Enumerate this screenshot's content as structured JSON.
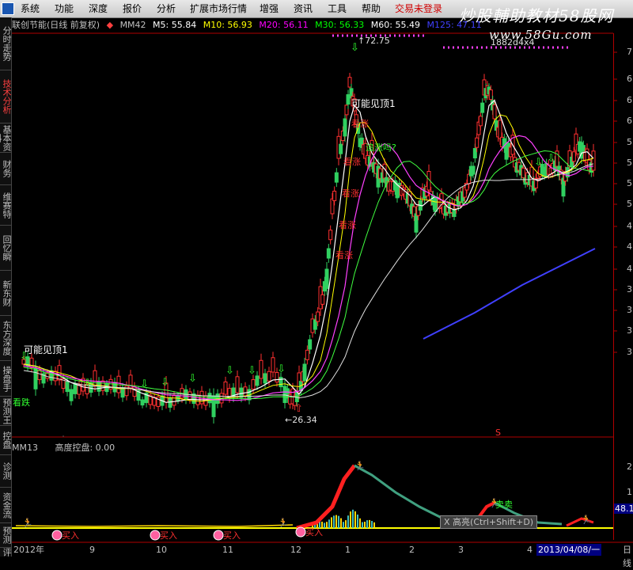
{
  "menu": {
    "items": [
      "系统",
      "功能",
      "深度",
      "报价",
      "分析",
      "扩展市场行情",
      "增强",
      "资讯",
      "工具",
      "帮助"
    ],
    "login": "交易未登录"
  },
  "brand": {
    "title": "炒股輔助教材58股网",
    "url": "www.58Gu.com"
  },
  "stock": {
    "title": "联创节能(日线 前复权)",
    "indicator": "MM42",
    "ma": [
      {
        "label": "M5: 55.84",
        "color": "#ffffff"
      },
      {
        "label": "M10: 56.93",
        "color": "#ffff00"
      },
      {
        "label": "M20: 56.11",
        "color": "#ff00ff"
      },
      {
        "label": "M30: 56.33",
        "color": "#00ff00"
      },
      {
        "label": "M60: 55.49",
        "color": "#ffffff"
      },
      {
        "label": "M125: 47.11",
        "color": "#4040ff"
      }
    ]
  },
  "side_tabs": [
    "分时走势",
    "技术分析",
    "基本资料",
    "财务",
    "维赛特",
    "回忆瞬",
    "新东财",
    "东方深度",
    "操盘手",
    "预测王",
    "控盘",
    "诊测",
    "资金流",
    "预测",
    "评"
  ],
  "price_ticks": [
    "7",
    "6",
    "6",
    "6",
    "5",
    "5",
    "5",
    "5",
    "4",
    "4",
    "4",
    "3",
    "3",
    "3",
    "3"
  ],
  "annotations": {
    "high": "72.75",
    "low": "26.34",
    "top_right": "1882d4x4",
    "maybe_top_1": "可能见顶1",
    "maybe_top_2": "可能见顶1",
    "fall": "看跌",
    "chase": "追涨吗?",
    "words_red": [
      "看涨",
      "看涨",
      "看涨",
      "看涨",
      "看涨"
    ],
    "s_mark": "S"
  },
  "indicator": {
    "name": "MM13",
    "label": "高度控盘: 0.00",
    "buy": "买入",
    "sell": "卖卖",
    "ticks": [
      "2",
      "1"
    ],
    "last_value": "48.1"
  },
  "tooltip": "X 高亮(Ctrl+Shift+D)",
  "dates": {
    "months": [
      "2012年",
      "9",
      "10",
      "11",
      "12",
      "1",
      "2",
      "3",
      "4"
    ],
    "current": "2013/04/08/一",
    "right": "日线"
  }
}
